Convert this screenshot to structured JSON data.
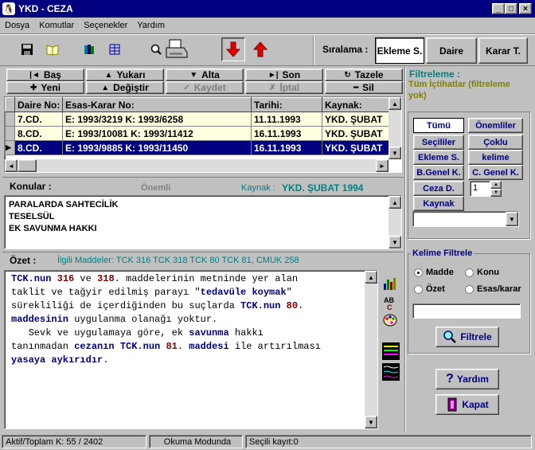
{
  "window": {
    "title": "YKD - CEZA",
    "minimize": "_",
    "maximize": "□",
    "close": "×"
  },
  "menu": [
    "Dosya",
    "Komutlar",
    "Seçenekler",
    "Yardım"
  ],
  "toolbar": {
    "icons": [
      "floppy-save",
      "open-book",
      "books",
      "grid-book",
      "search-print",
      "printer",
      "arrow-down",
      "arrow-up"
    ]
  },
  "sort": {
    "label": "Sıralama :",
    "buttons": [
      "Ekleme S.",
      "Daire",
      "Karar T."
    ],
    "active_index": 0
  },
  "nav": {
    "row1": [
      {
        "icon": "|◄",
        "label": "Baş"
      },
      {
        "icon": "▲",
        "label": "Yukarı"
      },
      {
        "icon": "▼",
        "label": "Alta"
      },
      {
        "icon": "►|",
        "label": "Son"
      },
      {
        "icon": "↻",
        "label": "Tazele"
      }
    ],
    "row2": [
      {
        "icon": "✚",
        "label": "Yeni",
        "disabled": false
      },
      {
        "icon": "▲",
        "label": "Değiştir",
        "disabled": false
      },
      {
        "icon": "✓",
        "label": "Kaydet",
        "disabled": true
      },
      {
        "icon": "✗",
        "label": "İptal",
        "disabled": true
      },
      {
        "icon": "━",
        "label": "Sil",
        "disabled": false
      }
    ]
  },
  "grid": {
    "columns": [
      "Daire No:",
      "Esas-Karar No:",
      "Tarihi:",
      "Kaynak:"
    ],
    "rows": [
      {
        "daire": "7.CD.",
        "esas": "E: 1993/3219  K: 1993/6258",
        "tarih": "11.11.1993",
        "kaynak": "YKD. ŞUBAT"
      },
      {
        "daire": "8.CD.",
        "esas": "E: 1993/10081  K: 1993/11412",
        "tarih": "16.11.1993",
        "kaynak": "YKD. ŞUBAT"
      },
      {
        "daire": "8.CD.",
        "esas": "E: 1993/9885  K: 1993/11450",
        "tarih": "16.11.1993",
        "kaynak": "YKD. ŞUBAT"
      }
    ],
    "selected_index": 2
  },
  "konular": {
    "label": "Konular :",
    "onemli": "Önemli",
    "kaynak_label": "Kaynak :",
    "kaynak_value": "YKD. ŞUBAT 1994",
    "items": [
      "PARALARDA SAHTECİLİK",
      "TESELSÜL",
      "EK SAVUNMA HAKKI"
    ]
  },
  "ozet": {
    "label": "Özet :",
    "ilgili": "İlgili Maddeler: TCK 316 TCK 318 TCK 80 TCK 81, CMUK 258",
    "lines": [
      [
        [
          "b",
          "TCK.nun"
        ],
        [
          "k",
          " "
        ],
        [
          "r",
          "316"
        ],
        [
          "k",
          " ve "
        ],
        [
          "r",
          "318"
        ],
        [
          "k",
          ". maddelerinin metninde yer alan"
        ]
      ],
      [
        [
          "k",
          "taklit ve tağyir edilmiş parayı \""
        ],
        [
          "b",
          "tedavüle koymak"
        ],
        [
          "k",
          "\""
        ]
      ],
      [
        [
          "k",
          "sürekliliği de içerdiğinden bu suçlarda "
        ],
        [
          "b",
          "TCK.nun"
        ],
        [
          "k",
          " "
        ],
        [
          "r",
          "80"
        ],
        [
          "k",
          "."
        ]
      ],
      [
        [
          "b",
          "maddesinin"
        ],
        [
          "k",
          " uygulanma olanağı yoktur."
        ]
      ],
      [
        [
          "k",
          "   Sevk ve uygulamaya göre, ek "
        ],
        [
          "b",
          "savunma"
        ],
        [
          "k",
          " hakkı"
        ]
      ],
      [
        [
          "k",
          "tanınmadan "
        ],
        [
          "b",
          "cezanın TCK.nun"
        ],
        [
          "k",
          " "
        ],
        [
          "r",
          "81"
        ],
        [
          "k",
          "."
        ],
        [
          "b",
          " maddesi"
        ],
        [
          "k",
          " ile artırılması"
        ]
      ],
      [
        [
          "b",
          "yasaya aykırıdır"
        ],
        [
          "k",
          "."
        ]
      ]
    ]
  },
  "filter": {
    "title": "Filtreleme :",
    "desc": "Tüm İçtihatlar (filtreleme yok)",
    "buttons": [
      "Tümü",
      "Önemliler",
      "Seçililer",
      "Çoklu",
      "Ekleme S.",
      "kelime",
      "B.Genel K.",
      "C. Genel K.",
      "Ceza D.",
      "Kaynak"
    ],
    "spin_value": "1",
    "kelime_title": "Kelime Filtrele",
    "radios": [
      {
        "label": "Madde",
        "on": true
      },
      {
        "label": "Konu",
        "on": false
      },
      {
        "label": "Özet",
        "on": false
      },
      {
        "label": "Esas/karar",
        "on": false
      }
    ],
    "input_value": "",
    "filtrele": "Filtrele"
  },
  "actions": {
    "yardim": "Yardım",
    "kapat": "Kapat"
  },
  "status": {
    "left": "Aktif/Toplam K: 55 / 2402",
    "mid": "Okuma Modunda",
    "right": "Seçili kayıt:0"
  }
}
